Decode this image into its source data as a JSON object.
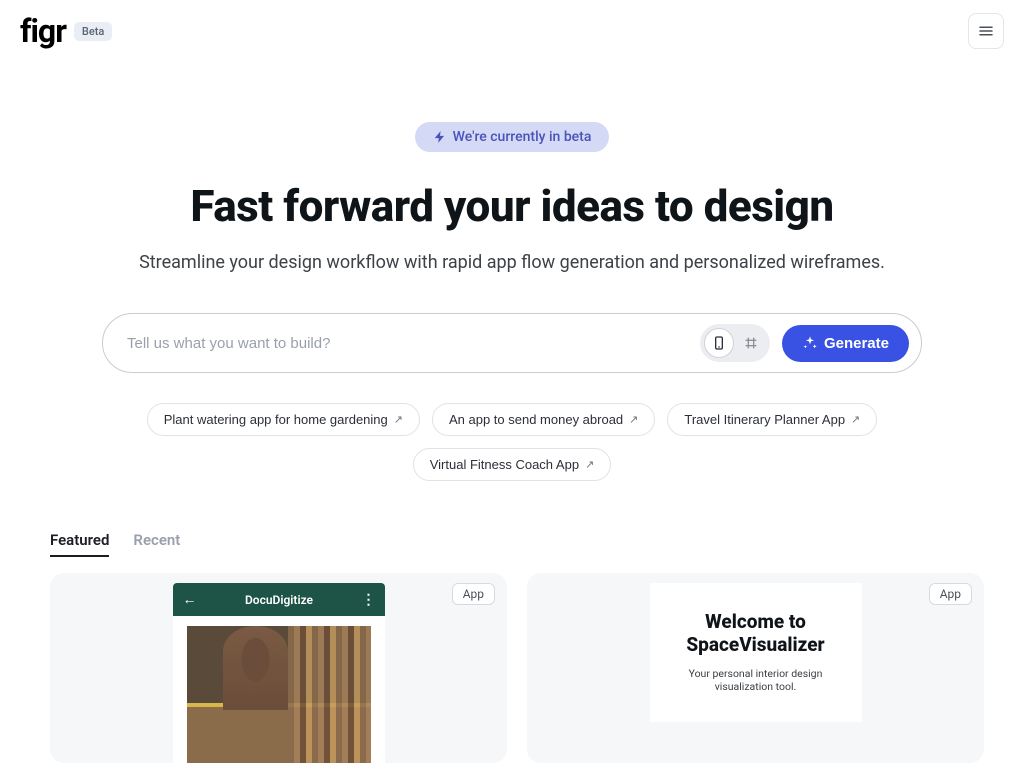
{
  "header": {
    "logo_text": "figr",
    "beta_chip": "Beta"
  },
  "hero": {
    "beta_banner": "We're currently in beta",
    "headline": "Fast forward your ideas to design",
    "subhead": "Streamline your design workflow with rapid app flow generation and personalized wireframes.",
    "prompt_placeholder": "Tell us what you want to build?",
    "generate_label": "Generate",
    "suggestions": [
      "Plant watering app for home gardening",
      "An app to send money abroad",
      "Travel Itinerary Planner App",
      "Virtual Fitness Coach App"
    ]
  },
  "gallery": {
    "tabs": {
      "featured": "Featured",
      "recent": "Recent"
    },
    "badge_label": "App",
    "cards": [
      {
        "app_title": "DocuDigitize"
      },
      {
        "welcome_line1": "Welcome to",
        "welcome_line2": "SpaceVisualizer",
        "tagline": "Your personal interior design visualization tool."
      }
    ]
  }
}
